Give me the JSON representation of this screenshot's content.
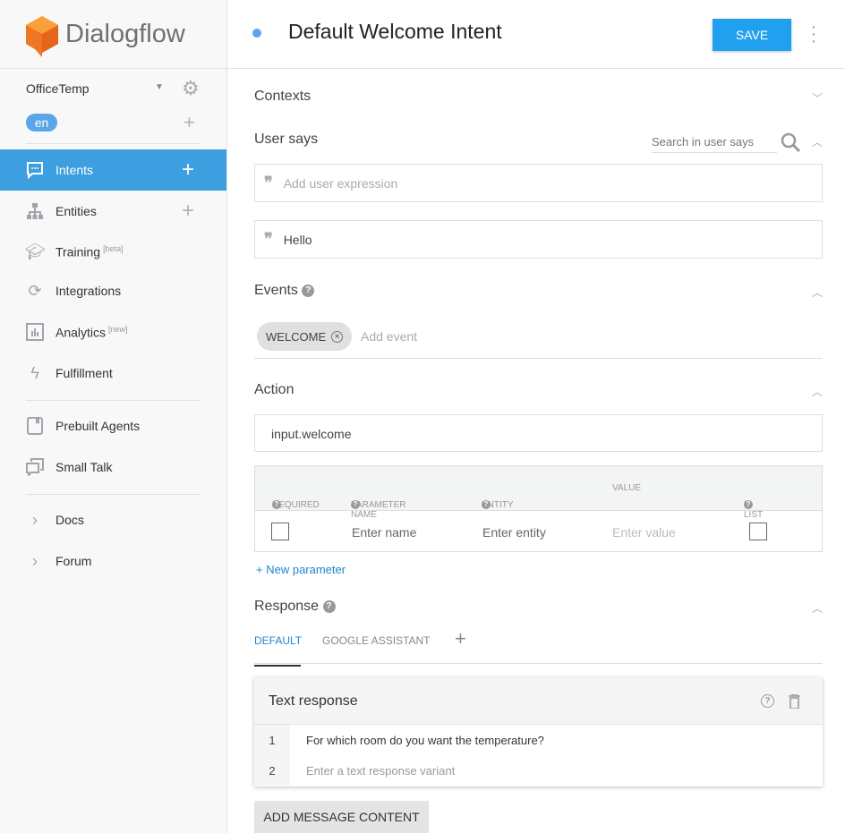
{
  "brand": {
    "name": "Dialogflow",
    "logo_color": "#ef7622"
  },
  "sidebar": {
    "agent": "OfficeTemp",
    "language": "en",
    "items": [
      {
        "label": "Intents",
        "icon": "chat-icon",
        "active": true
      },
      {
        "label": "Entities",
        "icon": "hierarchy-icon"
      },
      {
        "label": "Training",
        "badge": "[beta]",
        "icon": "graduation-cap-icon"
      },
      {
        "label": "Integrations",
        "icon": "sync-icon"
      },
      {
        "label": "Analytics",
        "badge": "[new]",
        "icon": "bar-chart-icon"
      },
      {
        "label": "Fulfillment",
        "icon": "bolt-icon"
      },
      {
        "label": "Prebuilt Agents",
        "icon": "book-icon"
      },
      {
        "label": "Small Talk",
        "icon": "chat-bubbles-icon"
      },
      {
        "label": "Docs",
        "icon": "chevron-right-icon"
      },
      {
        "label": "Forum",
        "icon": "chevron-right-icon"
      }
    ]
  },
  "header": {
    "title": "Default Welcome Intent",
    "save": "SAVE",
    "accent": "#21a0ef"
  },
  "contexts": {
    "title": "Contexts"
  },
  "user_says": {
    "title": "User says",
    "search_placeholder": "Search in user says",
    "add_placeholder": "Add user expression",
    "expressions": [
      "Hello"
    ]
  },
  "events": {
    "title": "Events",
    "chips": [
      "WELCOME"
    ],
    "add_placeholder": "Add event"
  },
  "action": {
    "title": "Action",
    "value": "input.welcome",
    "columns": [
      "REQUIRED",
      "PARAMETER NAME",
      "ENTITY",
      "VALUE",
      "IS LIST"
    ],
    "row": {
      "name_placeholder": "Enter name",
      "entity_placeholder": "Enter entity",
      "value_placeholder": "Enter value"
    },
    "new_parameter": "New parameter"
  },
  "response": {
    "title": "Response",
    "tabs": [
      "DEFAULT",
      "GOOGLE ASSISTANT"
    ],
    "active_tab": "DEFAULT",
    "card_title": "Text response",
    "rows": [
      {
        "n": "1",
        "text": "For which room do you want the temperature?"
      },
      {
        "n": "2",
        "placeholder": "Enter a text response variant"
      }
    ],
    "add_content": "ADD MESSAGE CONTENT"
  }
}
